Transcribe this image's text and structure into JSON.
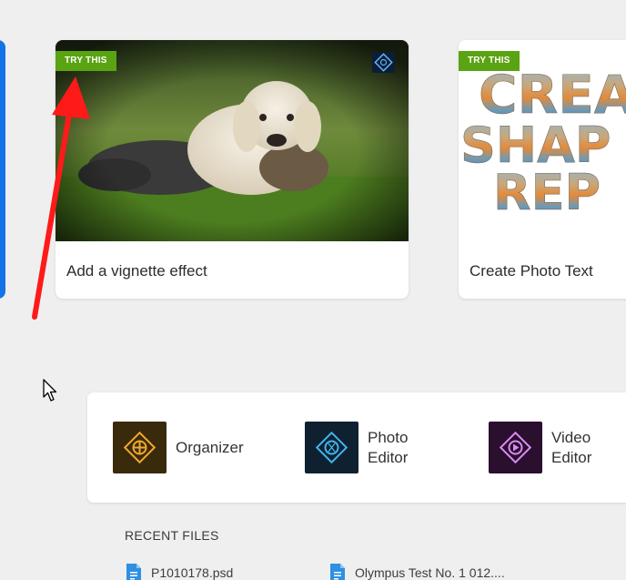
{
  "cards": [
    {
      "badge": "TRY THIS",
      "label": "Add a vignette effect",
      "app_icon": "photo-editor-icon"
    },
    {
      "badge": "TRY THIS",
      "label": "Create Photo Text",
      "thumb_text": [
        "CREA",
        "SHAP",
        "REP"
      ]
    }
  ],
  "launcher": {
    "items": [
      {
        "label": "Organizer",
        "icon": "organizer-icon"
      },
      {
        "label": "Photo\nEditor",
        "icon": "photo-editor-icon"
      },
      {
        "label": "Video\nEditor",
        "icon": "video-editor-icon"
      }
    ]
  },
  "recent": {
    "title": "RECENT FILES",
    "files": [
      {
        "name": "P1010178.psd",
        "icon": "psd-file-icon"
      },
      {
        "name": "Olympus Test No. 1 012....",
        "icon": "psd-file-icon"
      }
    ]
  },
  "colors": {
    "background": "#efefef",
    "badge_green": "#5aa312",
    "accent_blue": "#1473e6",
    "arrow_red": "#ff1a1a"
  }
}
